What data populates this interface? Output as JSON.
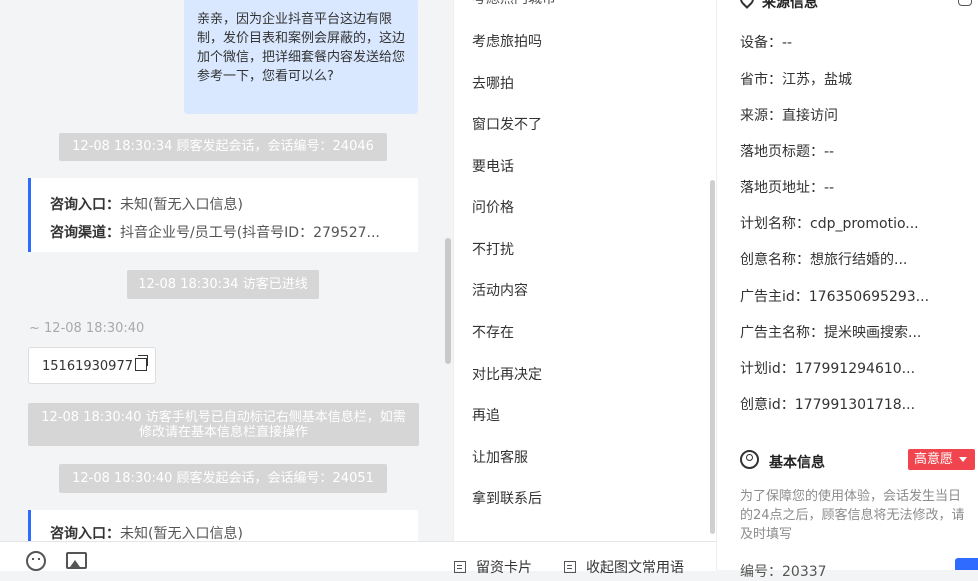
{
  "chat": {
    "outgoing_message": "亲亲，因为企业抖音平台这边有限制，发价目表和案例会屏蔽的，这边加个微信，把详细套餐内容发送给您参考一下，您看可以么?",
    "system_msgs": [
      "12-08 18:30:34 顾客发起会话，会话编号：24046",
      "12-08 18:30:34 访客已进线",
      "12-08 18:30:40 访客手机号已自动标记右侧基本信息栏，如需修改请在基本信息栏直接操作",
      "12-08 18:30:40 顾客发起会话，会话编号：24051"
    ],
    "card1": {
      "entry_label": "咨询入口：",
      "entry_value": "未知(暂无入口信息)",
      "channel_label": "咨询渠道：",
      "channel_value": "抖音企业号/员工号(抖音号ID：279527..."
    },
    "card2": {
      "entry_label": "咨询入口：",
      "entry_value": "未知(暂无入口信息)"
    },
    "visitor_time": "~ 12-08 18:30:40",
    "phone": "15161930977"
  },
  "input_toolbar": {
    "emoji_icon": "smile-icon",
    "image_icon": "image-icon",
    "card_label": "留资卡片",
    "phrases_label": "收起图文常用语"
  },
  "phrases": {
    "items": [
      "考虑旅拍吗",
      "去哪拍",
      "窗口发不了",
      "要电话",
      "问价格",
      "不打扰",
      "活动内容",
      "不存在",
      "对比再决定",
      "再追",
      "让加客服",
      "拿到联系后"
    ],
    "partial_top": "考虑热门城市"
  },
  "source_info": {
    "title": "来源信息",
    "rows": [
      "设备：--",
      "省市：江苏，盐城",
      "来源：直接访问",
      "落地页标题：--",
      "落地页地址：--",
      "计划名称：cdp_promotio...",
      "创意名称：想旅行结婚的...",
      "广告主id：176350695293...",
      "广告主名称：提米映画搜索...",
      "计划id：177991294610...",
      "创意id：177991301718..."
    ]
  },
  "basic_info": {
    "title": "基本信息",
    "intent_badge": "高意愿",
    "note": "为了保障您的使用体验，会话发生当日的24点之后，顾客信息将无法修改，请及时填写",
    "partial_row": "编号：20337"
  },
  "colors": {
    "accent": "#2f6bff",
    "badge": "#f0454e",
    "bubble": "#d9e8ff"
  }
}
